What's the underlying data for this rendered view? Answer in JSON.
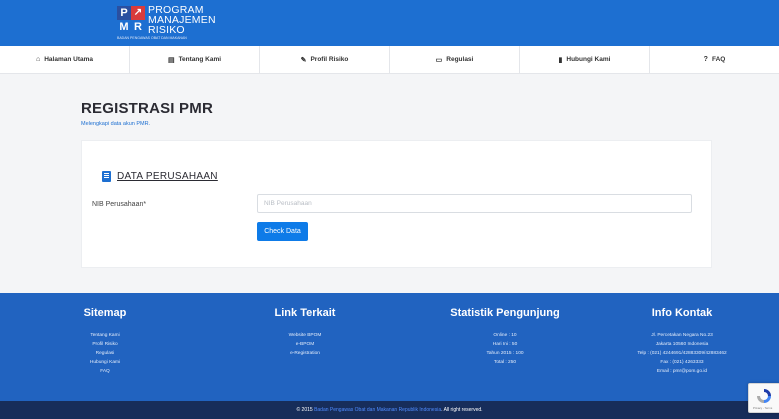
{
  "header": {
    "logo_letters": [
      "P",
      "M",
      "R"
    ],
    "logo_lines": [
      "PROGRAM",
      "MANAJEMEN",
      "RISIKO"
    ],
    "logo_tagline": "BADAN PENGAWAS OBAT DAN MAKANAN"
  },
  "nav": {
    "items": [
      {
        "label": "Halaman Utama",
        "icon": "home-icon",
        "glyph": "⌂"
      },
      {
        "label": "Tentang Kami",
        "icon": "id-card-icon",
        "glyph": "▤"
      },
      {
        "label": "Profil Risiko",
        "icon": "edit-icon",
        "glyph": "✎"
      },
      {
        "label": "Regulasi",
        "icon": "monitor-icon",
        "glyph": "▭"
      },
      {
        "label": "Hubungi Kami",
        "icon": "book-icon",
        "glyph": "▮"
      },
      {
        "label": "FAQ",
        "icon": "question-icon",
        "glyph": "?"
      }
    ]
  },
  "page": {
    "title": "REGISTRASI PMR",
    "subtitle": "Melengkapi data akun PMR."
  },
  "card": {
    "section_title": "DATA PERUSAHAAN",
    "field_label": "NIB Perusahaan*",
    "field_placeholder": "NIB Perusahaan",
    "field_value": "",
    "button_label": "Check Data"
  },
  "footer": {
    "sitemap": {
      "title": "Sitemap",
      "items": [
        "Tentang Kami",
        "Profil Risiko",
        "Regulasi",
        "Hubungi Kami",
        "FAQ"
      ]
    },
    "links": {
      "title": "Link Terkait",
      "items": [
        "Website BPOM",
        "e-BPOM",
        "e-Registration"
      ]
    },
    "stats": {
      "title": "Statistik Pengunjung",
      "items": [
        "Online : 10",
        "Hari Ini : 50",
        "Tahun 2015 : 100",
        "Total : 250"
      ]
    },
    "contact": {
      "title": "Info Kontak",
      "items": [
        "Jl. Percetakan Negara No.23",
        "Jakarta 10560 Indonesia",
        "Telp : (021) 4244691/42883309/42883462",
        "Fax : (021) 4263333",
        "Email : pmr@pom.go.id"
      ]
    }
  },
  "copyright": {
    "prefix": "© 2015",
    "org": "Badan Pengawas Obat dan Makanan Republik Indonesia",
    "suffix": ". All right reserved."
  },
  "recaptcha": {
    "text": "Privacy - Terms"
  },
  "colors": {
    "primary": "#1d6fd1",
    "footer_bg": "#2163c0",
    "bottom_bar": "#172d5a",
    "button": "#0e7be8"
  }
}
